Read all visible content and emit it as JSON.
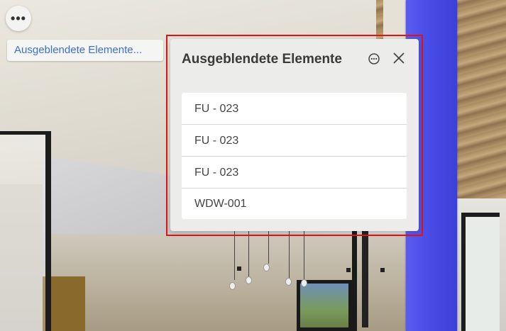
{
  "toolbar": {
    "more_glyph": "•••",
    "more_icon": "more-horizontal-icon"
  },
  "hidden_chip": {
    "label": "Ausgeblendete Elemente..."
  },
  "panel": {
    "title": "Ausgeblendete Elemente",
    "menu_icon": "more-circle-icon",
    "close_icon": "close-icon",
    "items": [
      {
        "label": "FU - 023"
      },
      {
        "label": "FU - 023"
      },
      {
        "label": "FU - 023"
      },
      {
        "label": "WDW-001"
      }
    ]
  },
  "colors": {
    "accent_link": "#3b6fd6",
    "highlight_border": "#e01414",
    "panel_bg": "#ececea",
    "selected_column": "#4a4ee6"
  }
}
